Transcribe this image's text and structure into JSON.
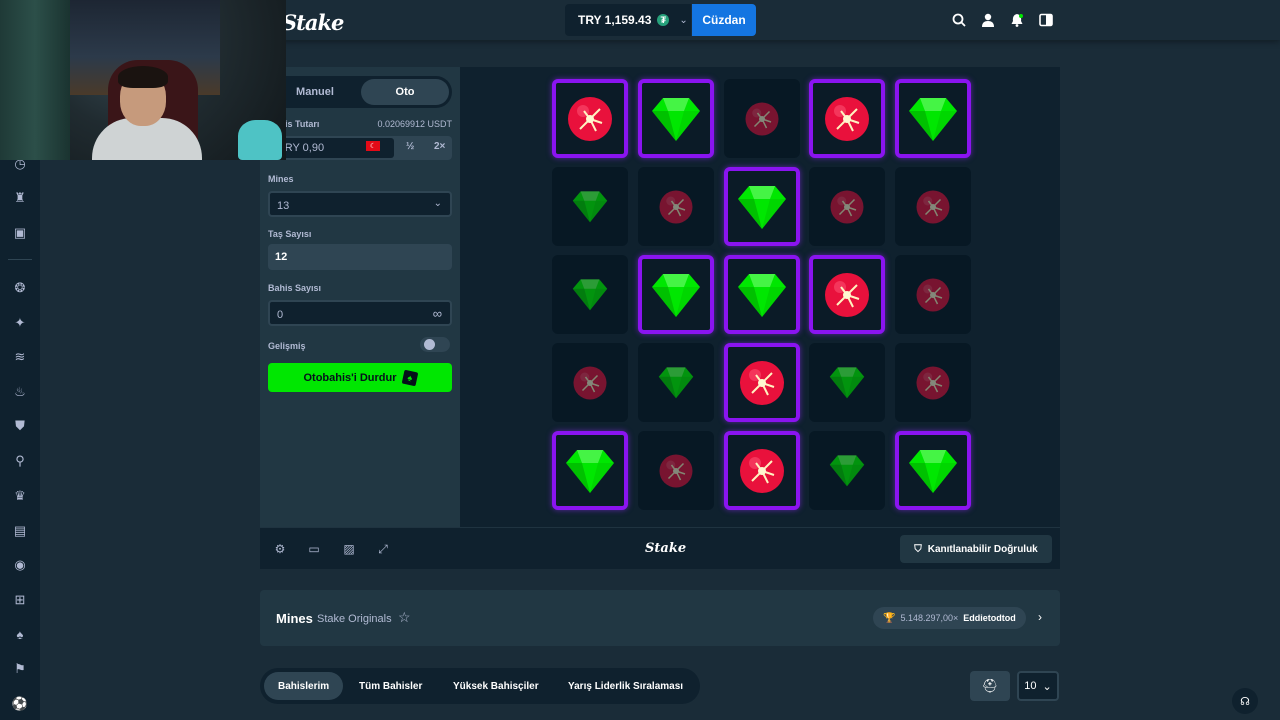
{
  "header": {
    "logo": "Stake",
    "balance": "TRY 1,159.43",
    "coin_icon": "tether-icon",
    "wallet_label": "Cüzdan",
    "icons": [
      "search-icon",
      "user-icon",
      "notification-icon",
      "sidebar-toggle-icon"
    ]
  },
  "sidebar": {
    "icons": [
      "clock-icon",
      "trophy-icon",
      "ticket-icon",
      "casino-icon",
      "sparkle-icon",
      "vip-icon",
      "fire-icon",
      "shirt-icon",
      "racket-icon",
      "crown-icon",
      "bag-icon",
      "live-icon",
      "gift-icon",
      "poker-icon",
      "sports-icon",
      "soccer-icon"
    ]
  },
  "panel": {
    "tab_manual": "Manuel",
    "tab_auto": "Oto",
    "bet_label": "Bahis Tutarı",
    "bet_usdt": "0.02069912 USDT",
    "bet_value": "TRY 0,90",
    "half": "½",
    "double": "2×",
    "mines_label": "Mines",
    "mines_value": "13",
    "gems_label": "Taş Sayısı",
    "gems_value": "12",
    "count_label": "Bahis Sayısı",
    "count_value": "0",
    "advanced_label": "Gelişmiş",
    "stop_label": "Otobahis'i Durdur"
  },
  "board": {
    "rows": [
      [
        {
          "type": "bomb",
          "revealed": true
        },
        {
          "type": "gem",
          "revealed": true
        },
        {
          "type": "bomb",
          "revealed": false
        },
        {
          "type": "bomb",
          "revealed": true
        },
        {
          "type": "gem",
          "revealed": true
        }
      ],
      [
        {
          "type": "gem",
          "revealed": false
        },
        {
          "type": "bomb",
          "revealed": false
        },
        {
          "type": "gem",
          "revealed": true
        },
        {
          "type": "bomb",
          "revealed": false
        },
        {
          "type": "bomb",
          "revealed": false
        }
      ],
      [
        {
          "type": "gem",
          "revealed": false
        },
        {
          "type": "gem",
          "revealed": true
        },
        {
          "type": "gem",
          "revealed": true
        },
        {
          "type": "bomb",
          "revealed": true
        },
        {
          "type": "bomb",
          "revealed": false
        }
      ],
      [
        {
          "type": "bomb",
          "revealed": false
        },
        {
          "type": "gem",
          "revealed": false
        },
        {
          "type": "bomb",
          "revealed": true
        },
        {
          "type": "gem",
          "revealed": false
        },
        {
          "type": "bomb",
          "revealed": false
        }
      ],
      [
        {
          "type": "gem",
          "revealed": true
        },
        {
          "type": "bomb",
          "revealed": false
        },
        {
          "type": "bomb",
          "revealed": true
        },
        {
          "type": "gem",
          "revealed": false
        },
        {
          "type": "gem",
          "revealed": true
        }
      ]
    ],
    "colors": {
      "gem": "#00e701",
      "bomb": "#e9113c",
      "highlight": "#8a14f0"
    }
  },
  "footer": {
    "icons": [
      "settings-icon",
      "fullscreen-icon",
      "stats-icon",
      "trend-icon"
    ],
    "logo": "Stake",
    "fairness_label": "Kanıtlanabilir Doğruluk"
  },
  "info": {
    "game": "Mines",
    "provider": "Stake Originals",
    "record_mult": "5.148.297,00×",
    "record_user": "Eddietodtod"
  },
  "tabs": [
    "Bahislerim",
    "Tüm Bahisler",
    "Yüksek Bahisçiler",
    "Yarış Liderlik Sıralaması"
  ],
  "page_size": "10"
}
